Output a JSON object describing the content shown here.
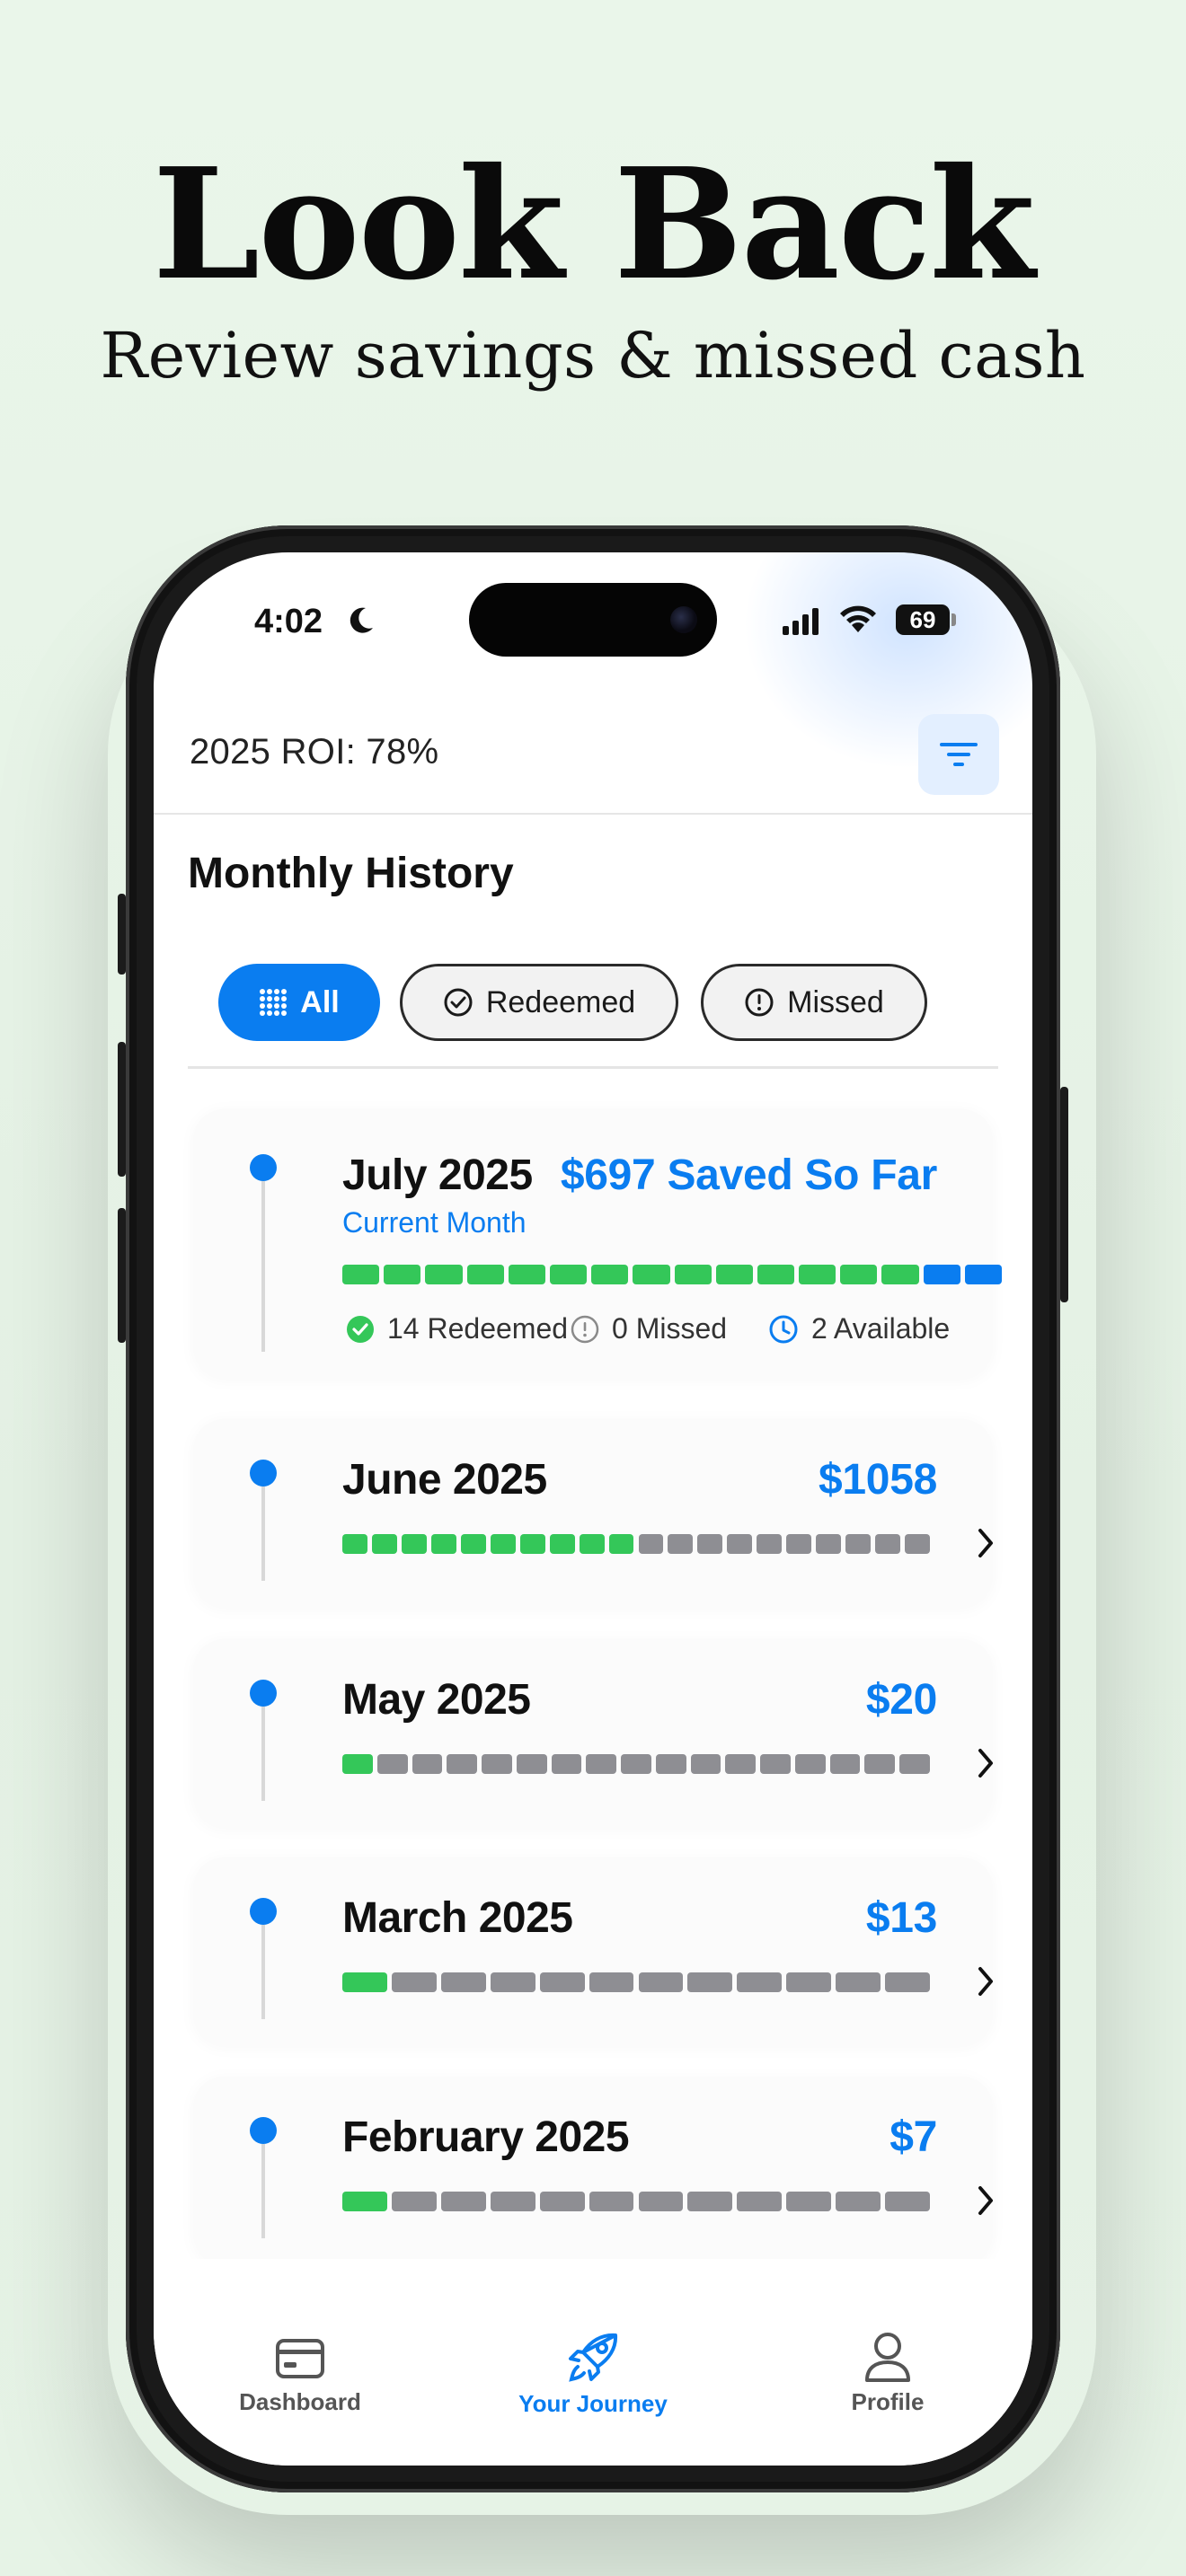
{
  "hero": {
    "title": "Look Back",
    "subtitle": "Review savings & missed cash"
  },
  "status_bar": {
    "time": "4:02",
    "battery": "69"
  },
  "header": {
    "roi": "2025 ROI: 78%",
    "filter_icon": "filter-lines-icon"
  },
  "history": {
    "title": "Monthly History",
    "filters": [
      {
        "label": "All",
        "icon": "grid-dots-icon",
        "selected": true
      },
      {
        "label": "Redeemed",
        "icon": "check-circle-icon",
        "selected": false
      },
      {
        "label": "Missed",
        "icon": "exclamation-circle-icon",
        "selected": false
      }
    ],
    "current": {
      "month": "July 2025",
      "amount": "$697 Saved So Far",
      "badge": "Current Month",
      "redeemed_count": 14,
      "available_count": 2,
      "redeemed": "14 Redeemed",
      "missed": "0 Missed",
      "available": "2 Available"
    },
    "months": [
      {
        "month": "June 2025",
        "amount": "$1058",
        "redeemed_count": 10,
        "total": 20
      },
      {
        "month": "May 2025",
        "amount": "$20",
        "redeemed_count": 1,
        "total": 17
      },
      {
        "month": "March 2025",
        "amount": "$13",
        "redeemed_count": 1,
        "total": 12
      },
      {
        "month": "February 2025",
        "amount": "$7",
        "redeemed_count": 1,
        "total": 12
      }
    ]
  },
  "tabbar": {
    "tabs": [
      {
        "label": "Dashboard",
        "icon": "credit-card-icon",
        "active": false
      },
      {
        "label": "Your Journey",
        "icon": "rocket-icon",
        "active": true
      },
      {
        "label": "Profile",
        "icon": "person-icon",
        "active": false
      }
    ]
  },
  "colors": {
    "accent": "#0a7df0",
    "redeemed": "#34c759",
    "missed": "#8e8e93",
    "available": "#0a7df0"
  }
}
